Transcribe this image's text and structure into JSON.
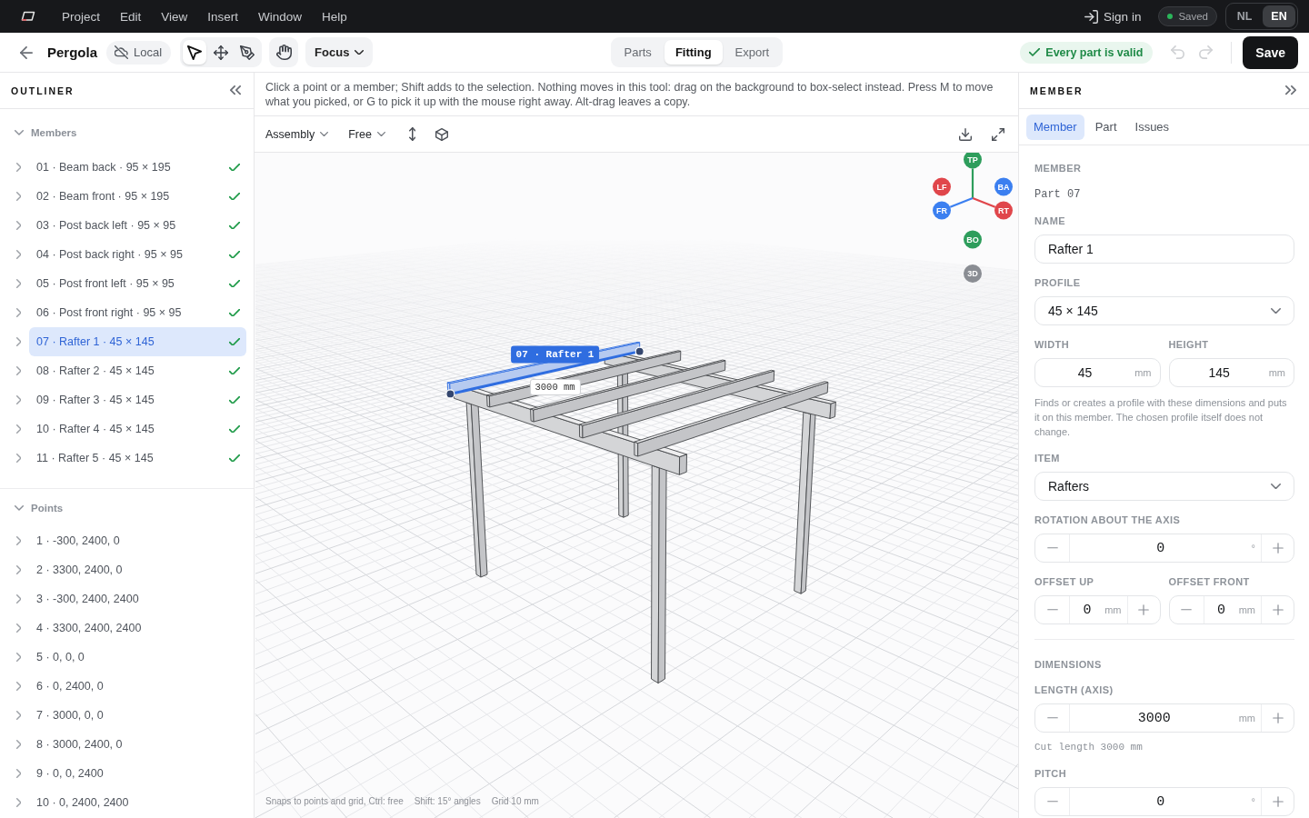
{
  "menubar": {
    "menus": [
      "Project",
      "Edit",
      "View",
      "Insert",
      "Window",
      "Help"
    ],
    "sign_in": "Sign in",
    "save_state": "Saved",
    "languages": [
      {
        "label": "NL",
        "selected": false
      },
      {
        "label": "EN",
        "selected": true
      }
    ]
  },
  "toolbar": {
    "project": "Pergola",
    "storage": "Local",
    "tools": [
      {
        "kind": "select",
        "selected": true
      },
      {
        "kind": "move",
        "selected": false
      },
      {
        "kind": "pen",
        "selected": false
      }
    ],
    "pan_tool": {
      "selected": false
    },
    "focus": "Focus",
    "modes": [
      {
        "label": "Parts",
        "selected": false
      },
      {
        "label": "Fitting",
        "selected": true
      },
      {
        "label": "Export",
        "selected": false
      }
    ],
    "validation": "Every part is valid",
    "undo": {
      "disabled": true
    },
    "redo": {
      "disabled": true
    },
    "save": "Save"
  },
  "outliner": {
    "title": "OUTLINER",
    "sections": [
      {
        "label": "Members",
        "expanded": true,
        "items": [
          {
            "label": "01 · Beam back · 95 × 195",
            "expanded": false,
            "valid": true,
            "selected": false
          },
          {
            "label": "02 · Beam front · 95 × 195",
            "expanded": false,
            "valid": true,
            "selected": false
          },
          {
            "label": "03 · Post back left · 95 × 95",
            "expanded": false,
            "valid": true,
            "selected": false
          },
          {
            "label": "04 · Post back right · 95 × 95",
            "expanded": false,
            "valid": true,
            "selected": false
          },
          {
            "label": "05 · Post front left · 95 × 95",
            "expanded": false,
            "valid": true,
            "selected": false
          },
          {
            "label": "06 · Post front right · 95 × 95",
            "expanded": false,
            "valid": true,
            "selected": false
          },
          {
            "label": "07 · Rafter 1 · 45 × 145",
            "expanded": false,
            "valid": true,
            "selected": true
          },
          {
            "label": "08 · Rafter 2 · 45 × 145",
            "expanded": false,
            "valid": true,
            "selected": false
          },
          {
            "label": "09 · Rafter 3 · 45 × 145",
            "expanded": false,
            "valid": true,
            "selected": false
          },
          {
            "label": "10 · Rafter 4 · 45 × 145",
            "expanded": false,
            "valid": true,
            "selected": false
          },
          {
            "label": "11 · Rafter 5 · 45 × 145",
            "expanded": false,
            "valid": true,
            "selected": false
          }
        ]
      },
      {
        "label": "Points",
        "expanded": true,
        "items": [
          {
            "label": "1 · -300, 2400, 0",
            "expanded": false,
            "selected": false
          },
          {
            "label": "2 · 3300, 2400, 0",
            "expanded": false,
            "selected": false
          },
          {
            "label": "3 · -300, 2400, 2400",
            "expanded": false,
            "selected": false
          },
          {
            "label": "4 · 3300, 2400, 2400",
            "expanded": false,
            "selected": false
          },
          {
            "label": "5 · 0, 0, 0",
            "expanded": false,
            "selected": false
          },
          {
            "label": "6 · 0, 2400, 0",
            "expanded": false,
            "selected": false
          },
          {
            "label": "7 · 3000, 0, 0",
            "expanded": false,
            "selected": false
          },
          {
            "label": "8 · 3000, 2400, 0",
            "expanded": false,
            "selected": false
          },
          {
            "label": "9 · 0, 0, 2400",
            "expanded": false,
            "selected": false
          },
          {
            "label": "10 · 0, 2400, 2400",
            "expanded": false,
            "selected": false
          }
        ]
      }
    ]
  },
  "viewport": {
    "hint": "Click a point or a member; Shift adds to the selection. Nothing moves in this tool: drag on the background to box-select instead. Press M to move what you picked, or G to pick it up with the mouse right away. Alt-drag leaves a copy.",
    "view_mode": "Assembly",
    "snap_mode": "Free",
    "gizmo": [
      {
        "label": "TP",
        "color": "#2e9d5c"
      },
      {
        "label": "LF",
        "color": "#e0464b"
      },
      {
        "label": "BA",
        "color": "#3b7ff0"
      },
      {
        "label": "FR",
        "color": "#3b7ff0"
      },
      {
        "label": "RT",
        "color": "#e0464b"
      },
      {
        "label": "BO",
        "color": "#2e9d5c"
      },
      {
        "label": "3D",
        "color": "#8a8d93"
      }
    ],
    "selection_tag": "07 · Rafter 1",
    "dimension_label": "3000 mm",
    "footer": [
      "Snaps to points and grid, Ctrl: free",
      "Shift: 15° angles",
      "Grid 10 mm"
    ]
  },
  "inspector": {
    "title": "MEMBER",
    "tabs": [
      {
        "label": "Member",
        "selected": true
      },
      {
        "label": "Part",
        "selected": false
      },
      {
        "label": "Issues",
        "selected": false
      }
    ],
    "sections": [
      {
        "rows": [
          {
            "kind": "caption",
            "label": "MEMBER",
            "value": "Part 07"
          },
          {
            "kind": "text",
            "label": "NAME",
            "value": "Rafter 1"
          },
          {
            "kind": "select",
            "label": "PROFILE",
            "value": "45 × 145"
          },
          {
            "kind": "pair",
            "fields": [
              {
                "label": "WIDTH",
                "value": "45",
                "unit": "mm"
              },
              {
                "label": "HEIGHT",
                "value": "145",
                "unit": "mm"
              }
            ]
          },
          {
            "kind": "help",
            "text": "Finds or creates a profile with these dimensions and puts it on this member. The chosen profile itself does not change."
          },
          {
            "kind": "select",
            "label": "ITEM",
            "value": "Rafters"
          },
          {
            "kind": "stepper",
            "label": "ROTATION ABOUT THE AXIS",
            "value": "0",
            "unit": "°"
          },
          {
            "kind": "stepper_pair",
            "fields": [
              {
                "label": "OFFSET UP",
                "value": "0",
                "unit": "mm"
              },
              {
                "label": "OFFSET FRONT",
                "value": "0",
                "unit": "mm"
              }
            ]
          }
        ]
      },
      {
        "heading": "DIMENSIONS",
        "rows": [
          {
            "kind": "stepper",
            "label": "LENGTH (AXIS)",
            "value": "3000",
            "unit": "mm"
          },
          {
            "kind": "note",
            "text": "Cut length 3000 mm"
          },
          {
            "kind": "stepper",
            "label": "PITCH",
            "value": "0",
            "unit": "°"
          }
        ]
      }
    ]
  }
}
